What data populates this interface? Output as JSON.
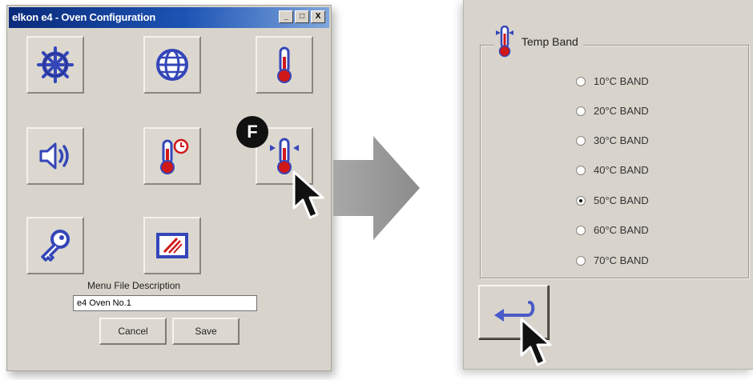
{
  "left_window": {
    "title": "elkon e4 - Oven Configuration",
    "controls": {
      "minimize": "_",
      "maximize": "□",
      "close": "X"
    },
    "tiles": [
      {
        "icon": "ship-wheel-icon"
      },
      {
        "icon": "globe-icon"
      },
      {
        "icon": "thermometer-icon"
      },
      {
        "icon": "speaker-icon"
      },
      {
        "icon": "thermometer-clock-icon"
      },
      {
        "icon": "thermometer-band-icon"
      },
      {
        "icon": "key-icon"
      },
      {
        "icon": "monitor-logo-icon"
      }
    ],
    "description_label": "Menu File Description",
    "description_value": "e4 Oven No.1",
    "cancel_label": "Cancel",
    "save_label": "Save",
    "step_marker": "F"
  },
  "right_panel": {
    "group_title": "Temp Band",
    "options": [
      {
        "label": "10°C BAND",
        "selected": false
      },
      {
        "label": "20°C BAND",
        "selected": false
      },
      {
        "label": "30°C BAND",
        "selected": false
      },
      {
        "label": "40°C BAND",
        "selected": false
      },
      {
        "label": "50°C BAND",
        "selected": true
      },
      {
        "label": "60°C BAND",
        "selected": false
      },
      {
        "label": "70°C BAND",
        "selected": false
      }
    ],
    "back_icon": "return-arrow-icon"
  },
  "colors": {
    "title_gradient_start": "#0a2a7a",
    "icon_blue": "#3446b8",
    "thermo_red": "#d01818",
    "transition_arrow": "#9a9a9a"
  }
}
